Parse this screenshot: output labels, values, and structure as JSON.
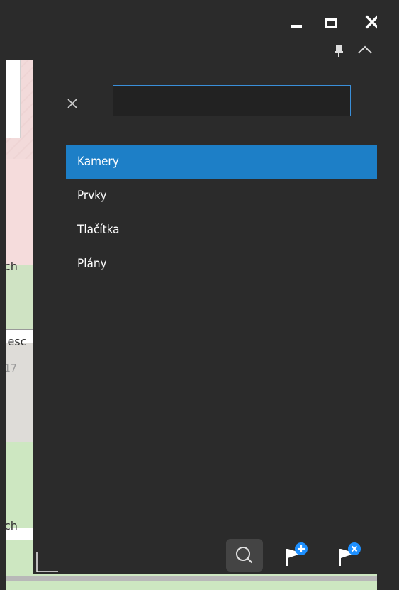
{
  "window": {
    "minimize_icon": "minimize-icon",
    "maximize_icon": "maximize-icon",
    "close_icon": "close-icon",
    "pin_icon": "pin-icon",
    "collapse_icon": "chevron-up-icon"
  },
  "map": {
    "labels": [
      "ch",
      "lesc",
      "17",
      "ch"
    ]
  },
  "search": {
    "value": "",
    "placeholder": "",
    "clear_icon": "close-icon"
  },
  "menu": {
    "items": [
      {
        "label": "Kamery",
        "active": true
      },
      {
        "label": "Prvky",
        "active": false
      },
      {
        "label": "Tlačítka",
        "active": false
      },
      {
        "label": "Plány",
        "active": false
      }
    ]
  },
  "toolbar": {
    "search_icon": "search-icon",
    "add_flag_icon": "flag-add-icon",
    "remove_flag_icon": "flag-remove-icon"
  },
  "colors": {
    "background": "#2b2b2b",
    "accent": "#1d7fc7",
    "badge": "#1e90ff",
    "input_border": "#3a8fd9"
  }
}
